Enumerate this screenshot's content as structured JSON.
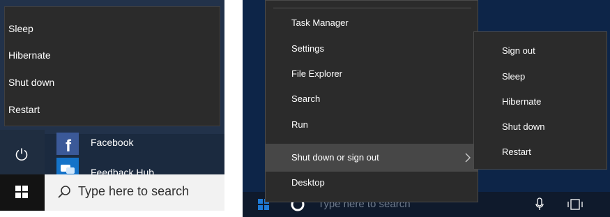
{
  "left_panel": {
    "power_menu": {
      "items": [
        "Sleep",
        "Hibernate",
        "Shut down",
        "Restart"
      ]
    },
    "tiles": [
      {
        "label": "Facebook",
        "icon": "facebook-icon"
      },
      {
        "label": "Feedback Hub",
        "icon": "feedback-hub-icon"
      }
    ],
    "taskbar": {
      "search_placeholder": "Type here to search",
      "start_icon": "windows-logo-icon"
    },
    "power_icon": "power-icon"
  },
  "right_panel": {
    "winx_menu": {
      "items": [
        "Task Manager",
        "Settings",
        "File Explorer",
        "Search",
        "Run",
        "Shut down or sign out",
        "Desktop"
      ],
      "highlighted_item": "Shut down or sign out"
    },
    "submenu": {
      "items": [
        "Sign out",
        "Sleep",
        "Hibernate",
        "Shut down",
        "Restart"
      ]
    },
    "taskbar": {
      "search_placeholder": "Type here to search",
      "icons": [
        "windows-logo-icon",
        "cortana-ring-icon",
        "microphone-icon",
        "task-view-icon"
      ]
    }
  },
  "colors": {
    "menu_bg": "#2b2b2b",
    "menu_highlight": "#474747",
    "left_bg": "#1b2a3f",
    "right_bg": "#0d2548",
    "facebook": "#3b5998",
    "feedback_hub": "#1473c9"
  }
}
